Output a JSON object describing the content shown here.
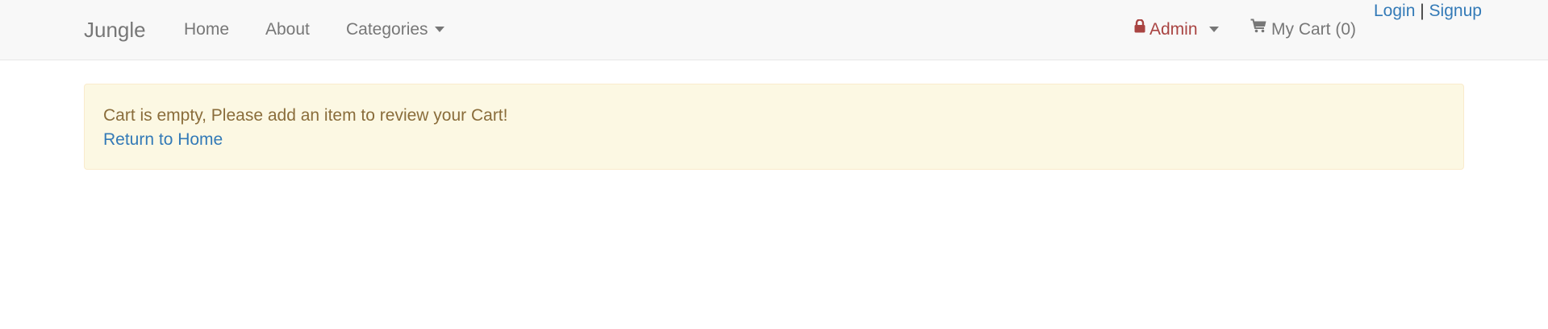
{
  "navbar": {
    "brand": "Jungle",
    "links": {
      "home": "Home",
      "about": "About",
      "categories": "Categories"
    },
    "admin_label": "Admin",
    "cart_label": "My Cart (0)"
  },
  "auth": {
    "login": "Login",
    "separator": "|",
    "signup": "Signup"
  },
  "alert": {
    "message": "Cart is empty, Please add an item to review your Cart!",
    "link_text": "Return to Home"
  },
  "icons": {
    "lock": "lock-icon",
    "cart": "shopping-cart-icon",
    "caret": "caret-down-icon"
  },
  "colors": {
    "navbar_bg": "#f8f8f8",
    "nav_text": "#777777",
    "admin_text": "#a94442",
    "link": "#337ab7",
    "alert_bg": "#fcf8e3",
    "alert_border": "#faebcc",
    "alert_text": "#8a6d3b"
  }
}
